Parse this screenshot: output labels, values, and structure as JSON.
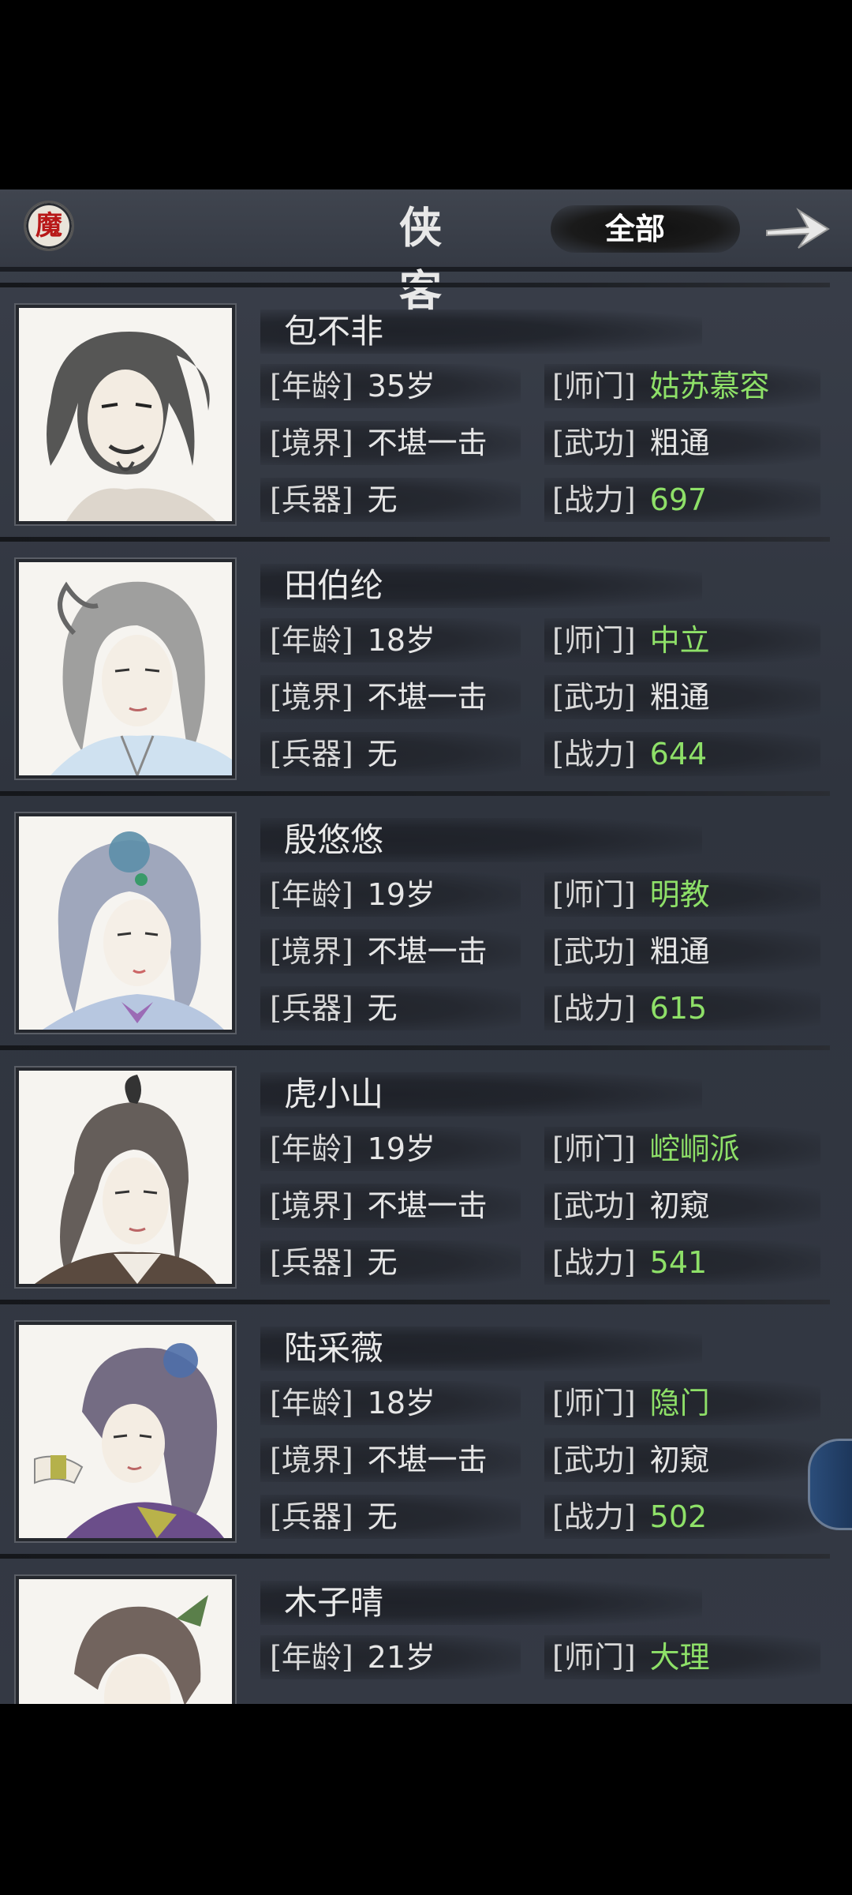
{
  "header": {
    "mo_icon_char": "魔",
    "title": "侠 客",
    "filter_label": "全部"
  },
  "labels": {
    "age": "[年龄]",
    "realm": "[境界]",
    "weapon": "[兵器]",
    "sect": "[师门]",
    "martial": "[武功]",
    "power": "[战力]"
  },
  "heroes": [
    {
      "name": "包不非",
      "age": "35岁",
      "realm": "不堪一击",
      "weapon": "无",
      "sect": "姑苏慕容",
      "martial": "粗通",
      "power": "697"
    },
    {
      "name": "田伯纶",
      "age": "18岁",
      "realm": "不堪一击",
      "weapon": "无",
      "sect": "中立",
      "martial": "粗通",
      "power": "644"
    },
    {
      "name": "殷悠悠",
      "age": "19岁",
      "realm": "不堪一击",
      "weapon": "无",
      "sect": "明教",
      "martial": "粗通",
      "power": "615"
    },
    {
      "name": "虎小山",
      "age": "19岁",
      "realm": "不堪一击",
      "weapon": "无",
      "sect": "崆峒派",
      "martial": "初窥",
      "power": "541"
    },
    {
      "name": "陆采薇",
      "age": "18岁",
      "realm": "不堪一击",
      "weapon": "无",
      "sect": "隐门",
      "martial": "初窥",
      "power": "502"
    },
    {
      "name": "木子晴",
      "age": "21岁",
      "sect": "大理"
    }
  ]
}
